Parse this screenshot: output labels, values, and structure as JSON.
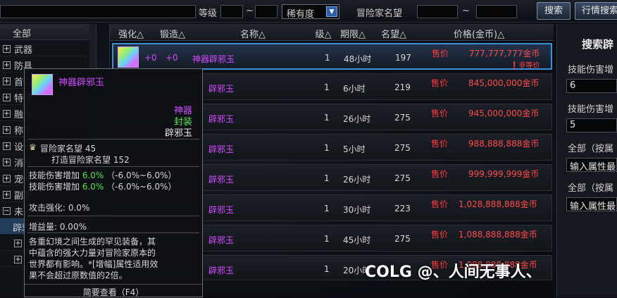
{
  "topbar": {
    "level_label": "等级",
    "tilde": "~",
    "rarity_value": "稀有度",
    "reputation_label": "冒险家名望",
    "search_button": "搜索",
    "market_search_button": "行情搜索"
  },
  "categories": {
    "all": "全部",
    "items": [
      {
        "label": "武器"
      },
      {
        "label": "防具"
      },
      {
        "label": "首饰"
      },
      {
        "label": "特殊"
      },
      {
        "label": "融合"
      },
      {
        "label": "称号"
      },
      {
        "label": "设计"
      },
      {
        "label": "消耗"
      },
      {
        "label": "宠物"
      },
      {
        "label": "副职"
      },
      {
        "label": "未分"
      },
      {
        "label": "辟邪"
      }
    ]
  },
  "table": {
    "headers": [
      "强化△",
      "锻造△",
      "名称△",
      "级△",
      "期限△",
      "名望△",
      "价格(金币)△"
    ],
    "rows": [
      {
        "enhance": "+0",
        "forge": "+0",
        "name": "神器辟邪玉",
        "level": "1",
        "period": "48小时",
        "fame": "197",
        "sell": "售价",
        "price": "777,777,777金币",
        "warn": "❗非等价"
      },
      {
        "name": "辟邪玉",
        "level": "1",
        "period": "6小时",
        "fame": "219",
        "sell": "售价",
        "price": "845,000,000金币"
      },
      {
        "name": "辟邪玉",
        "level": "1",
        "period": "26小时",
        "fame": "275",
        "sell": "售价",
        "price": "945,000,000金币"
      },
      {
        "name": "辟邪玉",
        "level": "1",
        "period": "5小时",
        "fame": "275",
        "sell": "售价",
        "price": "988,888,888金币"
      },
      {
        "name": "辟邪玉",
        "level": "1",
        "period": "26小时",
        "fame": "275",
        "sell": "售价",
        "price": "999,999,999金币"
      },
      {
        "name": "辟邪玉",
        "level": "1",
        "period": "30小时",
        "fame": "223",
        "sell": "售价",
        "price": "1,028,888,888金币"
      },
      {
        "name": "辟邪玉",
        "level": "1",
        "period": "45小时",
        "fame": "275",
        "sell": "售价",
        "price": "1,088,888,888金币"
      },
      {
        "name": "辟邪玉",
        "level": "1",
        "period": "20小时",
        "fame": "",
        "sell": "售价",
        "price": "1,088,888,888金币"
      }
    ]
  },
  "right_panel": {
    "title": "搜索辟",
    "filters": [
      {
        "label": "技能伤害增",
        "value": "6"
      },
      {
        "label": "技能伤害增",
        "value": "5"
      },
      {
        "label": "全部（按属",
        "value": "输入属性最"
      },
      {
        "label": "全部（按属",
        "value": "输入属性最"
      }
    ]
  },
  "tooltip": {
    "name": "神器辟邪玉",
    "rarity": "神器",
    "bind": "封装",
    "type": "辟邪玉",
    "fame": "冒险家名望 45",
    "forge_fame": "打造冒险家名望 152",
    "stat1_label": "技能伤害增加",
    "stat1_value": "6.0%",
    "stat1_range": "（-6.0%~6.0%）",
    "stat2_label": "技能伤害增加",
    "stat2_value": "6.0%",
    "stat2_range": "（-6.0%~6.0%）",
    "attack_enhance": "攻击强化: 0.0%",
    "amplify": "增益量: 0.00%",
    "desc1": "各重幻境之间生成的罕见装备，其",
    "desc2": "中蕴含的强大力量对冒险家原本的",
    "desc3": "世界都有影响。*[增幅]属性适用效",
    "desc4": "果不会超过原数值的2倍。",
    "footer": "简要查看（F4）"
  },
  "watermark": "COLG @、人间无事人、"
}
